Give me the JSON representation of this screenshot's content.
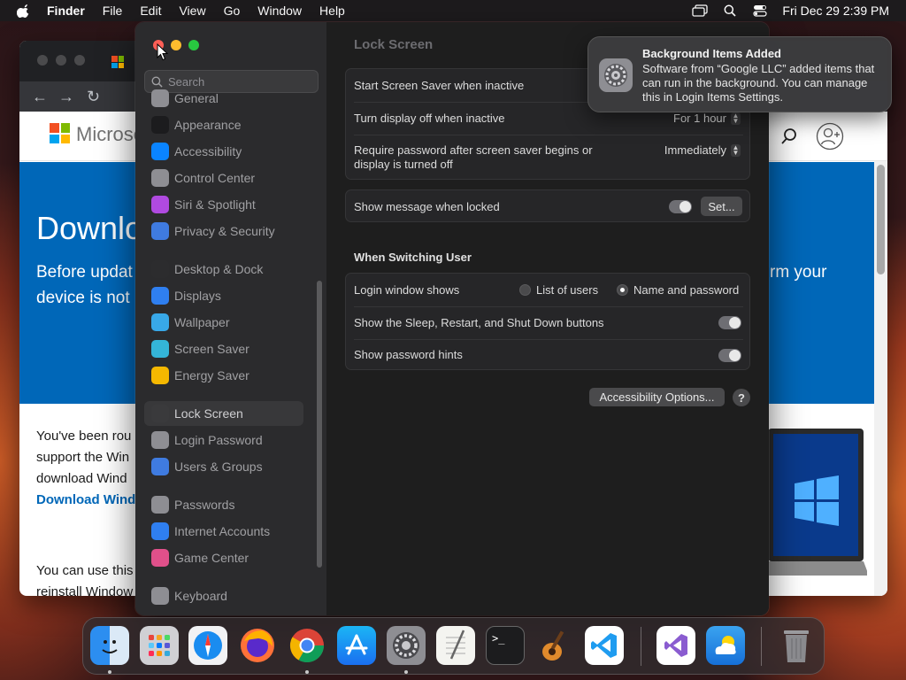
{
  "menubar": {
    "app_name": "Finder",
    "items": [
      "File",
      "Edit",
      "View",
      "Go",
      "Window",
      "Help"
    ],
    "clock": "Fri Dec 29  2:39 PM"
  },
  "browser": {
    "logo_text": "Microso",
    "hero_title": "Downlo",
    "hero_line1": "Before updat",
    "hero_line2": "device is not",
    "hero_right": "rm your",
    "body_line1": "You've been rou",
    "body_line2": "support the Win",
    "body_line3": "download Wind",
    "body_link": "Download Wind",
    "body_line4": "You can use this",
    "body_line5": "reinstall Window"
  },
  "settings": {
    "search_placeholder": "Search",
    "sidebar": [
      {
        "label": "General",
        "icon": "gear-icon",
        "color": "#8e8e93"
      },
      {
        "label": "Appearance",
        "icon": "appearance-icon",
        "color": "#1c1c1e"
      },
      {
        "label": "Accessibility",
        "icon": "accessibility-icon",
        "color": "#0a84ff"
      },
      {
        "label": "Control Center",
        "icon": "control-center-icon",
        "color": "#8e8e93"
      },
      {
        "label": "Siri & Spotlight",
        "icon": "siri-icon",
        "color": "#b04ae0"
      },
      {
        "label": "Privacy & Security",
        "icon": "hand-icon",
        "color": "#3f7be0"
      },
      {
        "label": "Desktop & Dock",
        "icon": "dock-icon",
        "color": "#2c2c2e"
      },
      {
        "label": "Displays",
        "icon": "display-icon",
        "color": "#2f7ff0"
      },
      {
        "label": "Wallpaper",
        "icon": "wallpaper-icon",
        "color": "#38a8e8"
      },
      {
        "label": "Screen Saver",
        "icon": "screen-saver-icon",
        "color": "#34b5d8"
      },
      {
        "label": "Energy Saver",
        "icon": "battery-icon",
        "color": "#f5b800"
      },
      {
        "label": "Lock Screen",
        "icon": "lock-icon",
        "color": "#3a3a3c"
      },
      {
        "label": "Login Password",
        "icon": "login-password-icon",
        "color": "#8e8e93"
      },
      {
        "label": "Users & Groups",
        "icon": "users-icon",
        "color": "#3f7be0"
      },
      {
        "label": "Passwords",
        "icon": "key-icon",
        "color": "#8e8e93"
      },
      {
        "label": "Internet Accounts",
        "icon": "at-icon",
        "color": "#2f7ff0"
      },
      {
        "label": "Game Center",
        "icon": "game-center-icon",
        "color": "#e0508a"
      },
      {
        "label": "Keyboard",
        "icon": "keyboard-icon",
        "color": "#8e8e93"
      }
    ],
    "active_item": "Lock Screen",
    "content_title": "Lock Screen",
    "rows": {
      "screen_saver": "Start Screen Saver when inactive",
      "display_off": "Turn display off when inactive",
      "display_off_value": "For 1 hour",
      "require_password_l1": "Require password after screen saver begins or",
      "require_password_l2": "display is turned off",
      "require_password_value": "Immediately",
      "show_message": "Show message when locked",
      "set_button": "Set...",
      "switching_title": "When Switching User",
      "login_window": "Login window shows",
      "radio_list": "List of users",
      "radio_name": "Name and password",
      "sleep_buttons": "Show the Sleep, Restart, and Shut Down buttons",
      "password_hints": "Show password hints"
    },
    "accessibility_button": "Accessibility Options...",
    "help_button": "?"
  },
  "notification": {
    "title": "Background Items Added",
    "body": "Software from “Google LLC” added items that can run in the background. You can manage this in Login Items Settings."
  }
}
